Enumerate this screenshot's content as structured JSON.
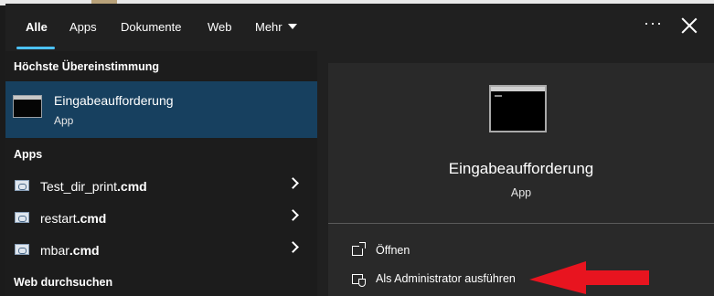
{
  "tabs": [
    {
      "label": "Alle"
    },
    {
      "label": "Apps"
    },
    {
      "label": "Dokumente"
    },
    {
      "label": "Web"
    },
    {
      "label": "Mehr"
    }
  ],
  "best_match": {
    "section_title": "Höchste Übereinstimmung",
    "name": "Eingabeaufforderung",
    "type": "App"
  },
  "apps": {
    "section_title": "Apps",
    "items": [
      {
        "name": "Test_dir_print",
        "ext": ".cmd"
      },
      {
        "name": "restart",
        "ext": ".cmd"
      },
      {
        "name": "mbar",
        "ext": ".cmd"
      }
    ]
  },
  "web": {
    "section_title": "Web durchsuchen"
  },
  "preview": {
    "title": "Eingabeaufforderung",
    "type": "App",
    "actions": [
      {
        "label": "Öffnen",
        "icon": "open-icon"
      },
      {
        "label": "Als Administrator ausführen",
        "icon": "shield-icon"
      }
    ]
  },
  "colors": {
    "accent": "#4cc2ff",
    "selection": "#17405f",
    "annotation_arrow": "#e8141f"
  }
}
